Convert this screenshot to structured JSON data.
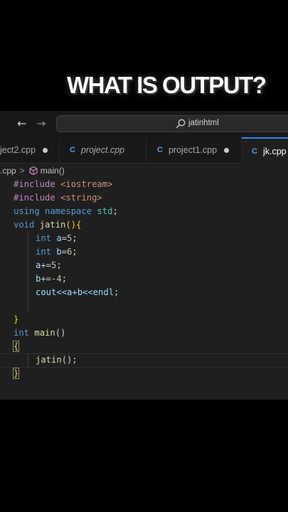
{
  "headline": "WHAT IS OUTPUT?",
  "titlebar": {
    "back_icon": "←",
    "forward_icon": "→",
    "search_text": "jatinhtml"
  },
  "tabs": [
    {
      "label": "ject2.cpp",
      "icon": "",
      "modified": true,
      "active": false,
      "italic": false
    },
    {
      "label": "project.cpp",
      "icon": "C",
      "modified": false,
      "active": false,
      "italic": true
    },
    {
      "label": "project1.cpp",
      "icon": "C",
      "modified": true,
      "active": false,
      "italic": false
    },
    {
      "label": "jk.cpp",
      "icon": "C",
      "modified": false,
      "active": true,
      "italic": false
    }
  ],
  "breadcrumb": {
    "file": ".cpp",
    "separator": ">",
    "symbol": "main()"
  },
  "code": {
    "l1_directive": "#include",
    "l1_header": "<iostream>",
    "l2_directive": "#include",
    "l2_header": "<string>",
    "l3_using": "using",
    "l3_namespace": "namespace",
    "l3_std": "std",
    "l3_semi": ";",
    "l4_void": "void",
    "l4_name": "jatin",
    "l4_rest": "(){",
    "l5_type": "int",
    "l5_var": "a",
    "l5_eq": "=",
    "l5_val": "5",
    "l5_semi": ";",
    "l6_type": "int",
    "l6_var": "b",
    "l6_eq": "=",
    "l6_val": "6",
    "l6_semi": ";",
    "l7_var": "a",
    "l7_op": "+=",
    "l7_val": "5",
    "l7_semi": ";",
    "l8_var": "b",
    "l8_op": "+=",
    "l8_val": "-4",
    "l8_semi": ";",
    "l9_text": "cout<<a+b<<endl;",
    "l11_brace": "}",
    "l12_type": "int",
    "l12_name": "main",
    "l12_paren": "()",
    "l13_brace": "{",
    "l14_call": "jatin",
    "l14_rest": "();",
    "l15_brace": "}"
  },
  "colors": {
    "background": "#000000",
    "editor_bg": "#1f1f1f",
    "accent_tab_border": "#2a8cf0"
  }
}
